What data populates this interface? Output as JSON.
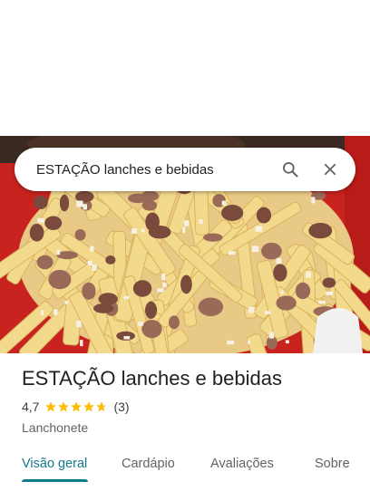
{
  "search": {
    "query": "ESTAÇÃO lanches e bebidas",
    "search_icon": "search-icon",
    "close_icon": "close-icon"
  },
  "place": {
    "name": "ESTAÇÃO lanches e bebidas",
    "rating": "4,7",
    "stars_value": 4.7,
    "stars_max": 5,
    "review_count": "(3)",
    "category": "Lanchonete"
  },
  "tabs": [
    {
      "label": "Visão geral",
      "active": true
    },
    {
      "label": "Cardápio",
      "active": false
    },
    {
      "label": "Avaliações",
      "active": false
    },
    {
      "label": "Sobre",
      "active": false
    }
  ],
  "colors": {
    "accent": "#137a8c",
    "star": "#fbbc04",
    "star_empty": "#dadce0"
  }
}
